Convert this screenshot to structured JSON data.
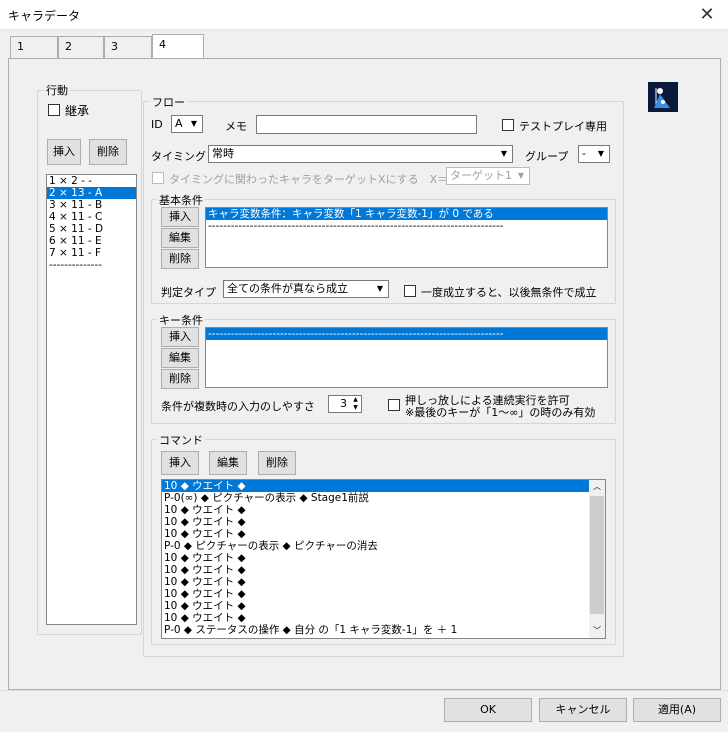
{
  "window": {
    "title": "キャラデータ",
    "close": "✕"
  },
  "tabs": [
    {
      "label": "1"
    },
    {
      "label": "2"
    },
    {
      "label": "3"
    },
    {
      "label": "4"
    }
  ],
  "koudou": {
    "label": "行動",
    "inherit_label": "継承",
    "insert": "挿入",
    "delete": "削除",
    "items": [
      "1 × 2 - -",
      "2 × 13 - A",
      "3 × 11 - B",
      "4 × 11 - C",
      "5 × 11 - D",
      "6 × 11 - E",
      "7 × 11 - F",
      "--------------"
    ]
  },
  "flow": {
    "label": "フロー",
    "id_label": "ID",
    "id_value": "A",
    "memo_label": "メモ",
    "memo_value": "",
    "testplay_label": "テストプレイ専用",
    "timing_label": "タイミング",
    "timing_value": "常時",
    "group_label": "グループ",
    "group_value": "-",
    "target_label": "タイミングに関わったキャラをターゲットXにする　X＝",
    "target_value": "ターゲット1"
  },
  "basic": {
    "label": "基本条件",
    "insert": "挿入",
    "edit": "編集",
    "delete": "削除",
    "items": [
      "キャラ変数条件：キャラ変数「1 キャラ変数-1」が 0 である",
      "------------------------------------------------------------------------------"
    ],
    "judge_label": "判定タイプ",
    "judge_value": "全ての条件が真なら成立",
    "once_label": "一度成立すると、以後無条件で成立"
  },
  "key": {
    "label": "キー条件",
    "insert": "挿入",
    "edit": "編集",
    "delete": "削除",
    "items": [
      "------------------------------------------------------------------------------"
    ],
    "ease_label": "条件が複数時の入力のしやすさ",
    "ease_value": "3",
    "hold_label": "押しっ放しによる連続実行を許可",
    "hold_note": "※最後のキーが「1〜∞」の時のみ有効"
  },
  "command": {
    "label": "コマンド",
    "insert": "挿入",
    "edit": "編集",
    "delete": "削除",
    "items": [
      "10 ◆ ウエイト ◆",
      "P-0(∞) ◆ ピクチャーの表示 ◆ Stage1前説",
      "10 ◆ ウエイト ◆",
      "10 ◆ ウエイト ◆",
      "10 ◆ ウエイト ◆",
      "P-0 ◆ ピクチャーの表示 ◆ ピクチャーの消去",
      "10 ◆ ウエイト ◆",
      "10 ◆ ウエイト ◆",
      "10 ◆ ウエイト ◆",
      "10 ◆ ウエイト ◆",
      "10 ◆ ウエイト ◆",
      "10 ◆ ウエイト ◆",
      "P-0 ◆ ステータスの操作 ◆ 自分 の「1 キャラ変数-1」を ＋ 1"
    ]
  },
  "footer": {
    "ok": "OK",
    "cancel": "キャンセル",
    "apply": "適用(A)"
  },
  "colors": {
    "selection": "#0078d7",
    "icon_bg": "#0a1a3a",
    "icon_fg": "#3a8ee6"
  }
}
